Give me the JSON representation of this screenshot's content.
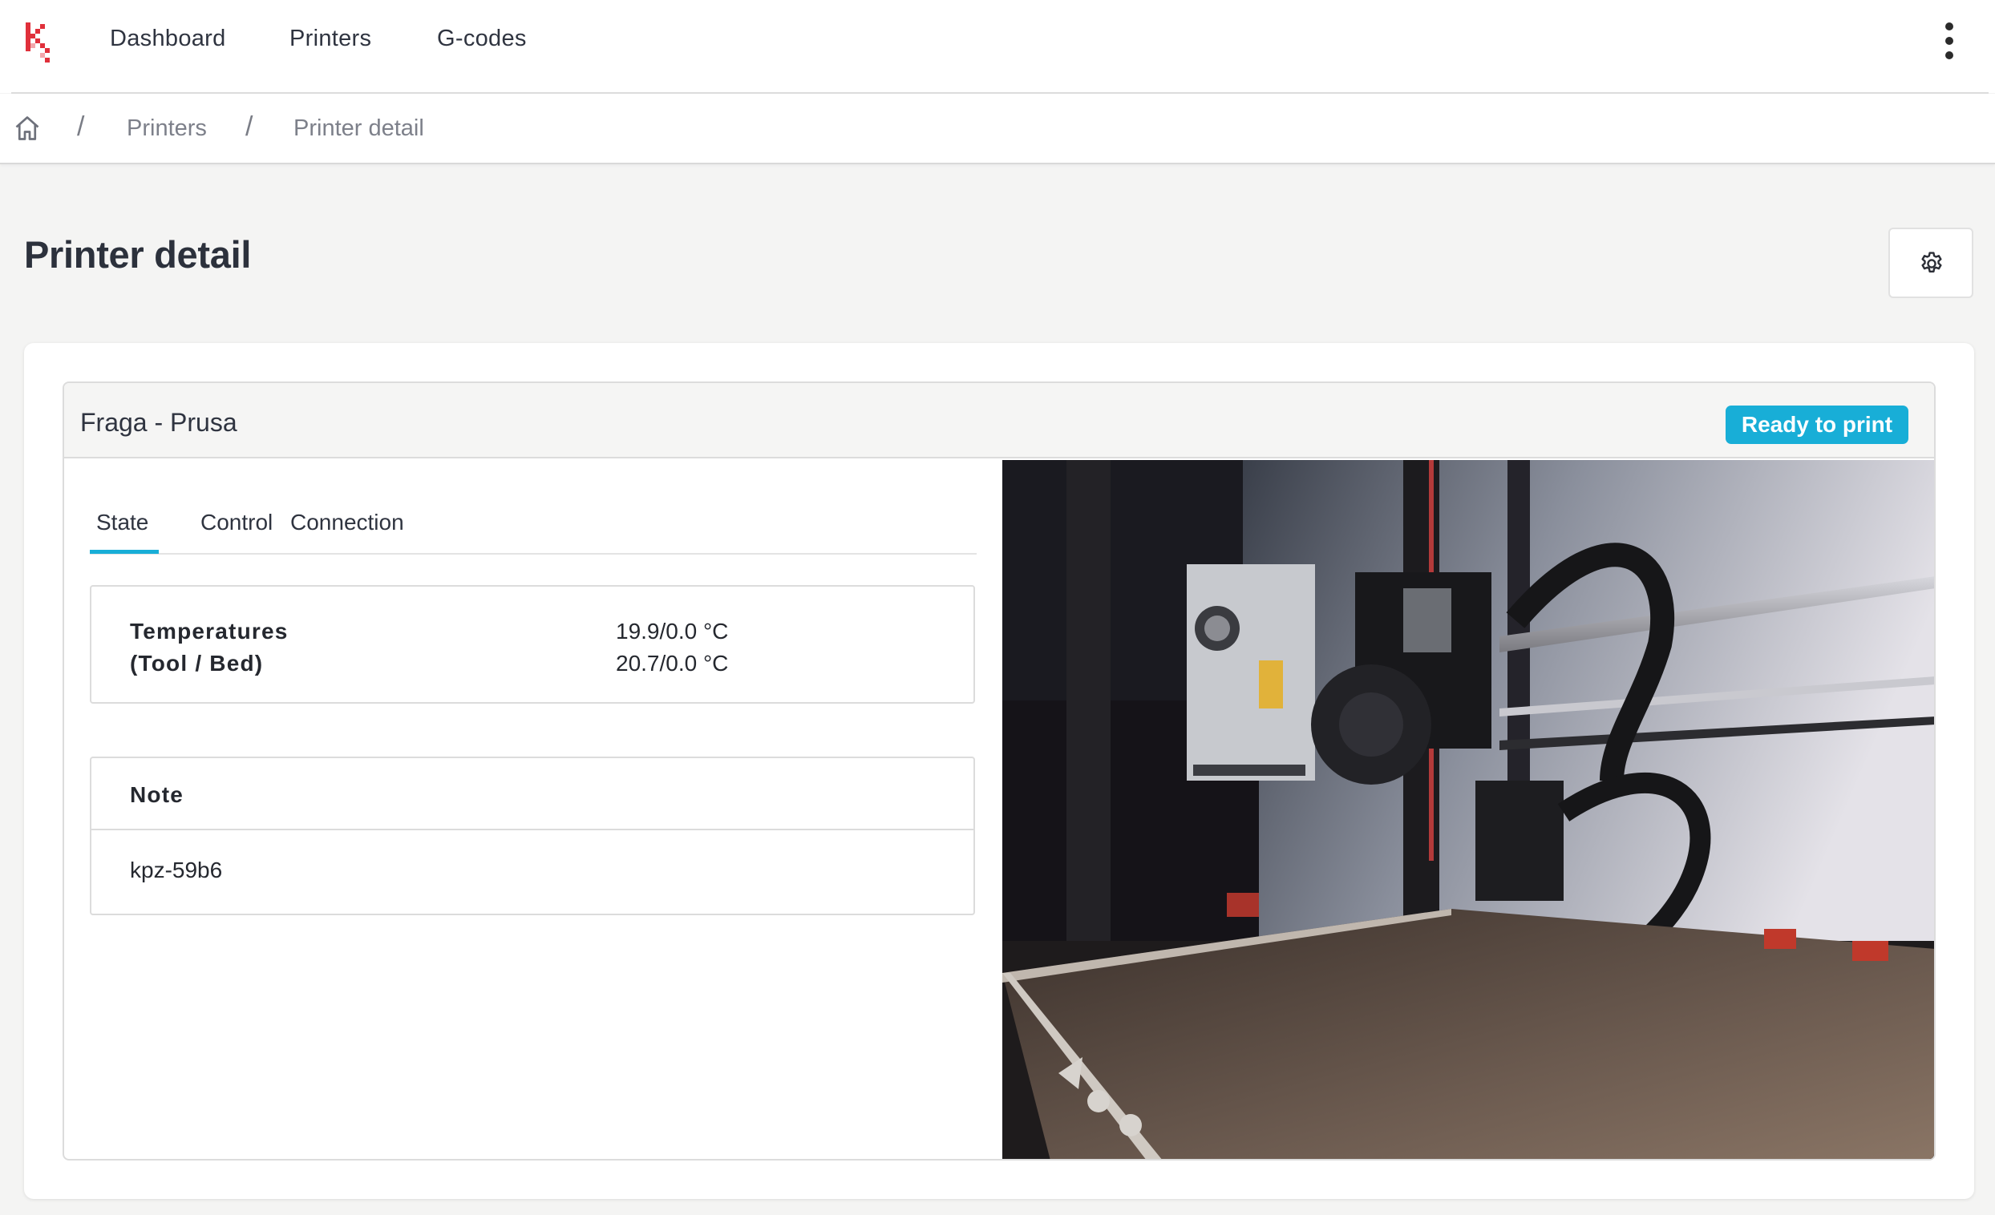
{
  "nav": {
    "items": [
      {
        "label": "Dashboard"
      },
      {
        "label": "Printers"
      },
      {
        "label": "G-codes"
      }
    ]
  },
  "breadcrumb": {
    "items": [
      {
        "label": "Printers"
      },
      {
        "label": "Printer detail"
      }
    ]
  },
  "page": {
    "title": "Printer detail"
  },
  "printer": {
    "name": "Fraga - Prusa",
    "status": "Ready to print",
    "tabs": [
      {
        "label": "State",
        "active": true
      },
      {
        "label": "Control",
        "active": false
      },
      {
        "label": "Connection",
        "active": false
      }
    ],
    "temperatures": {
      "label_line1": "Temperatures",
      "label_line2": "(Tool / Bed)",
      "tool": "19.9/0.0 °C",
      "bed": "20.7/0.0 °C"
    },
    "note": {
      "title": "Note",
      "value": "kpz-59b6"
    }
  },
  "colors": {
    "accent": "#18aed7",
    "logo_red": "#e0303b",
    "background": "#f4f4f3"
  },
  "icons": {
    "logo": "brand-logo",
    "menu": "kebab-menu-icon",
    "home": "home-icon",
    "settings": "gear-icon"
  }
}
